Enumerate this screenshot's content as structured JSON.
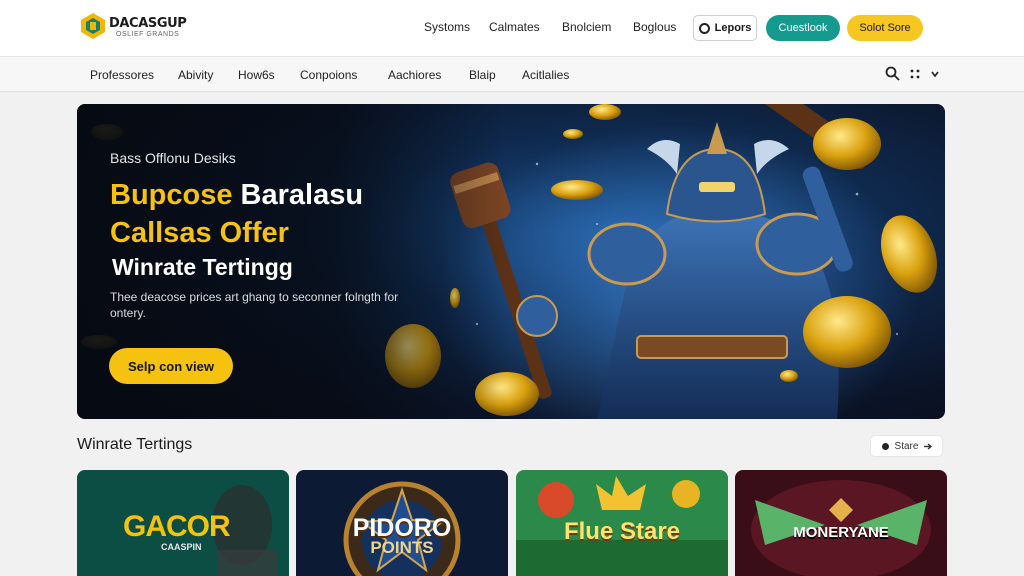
{
  "brand": {
    "title": "DACASGUP",
    "subtitle": "OSLIEF GRANDS"
  },
  "topnav": [
    "Systoms",
    "Calmates",
    "Bnolciem",
    "Boglous"
  ],
  "actions": {
    "login": "Lepors",
    "primary": "Cuestlook",
    "secondary": "Solot Sore"
  },
  "categories": [
    "Professores",
    "Abivity",
    "How6s",
    "Conpoions",
    "Aachiores",
    "Blaip",
    "Acitlalies"
  ],
  "hero": {
    "kicker": "Bass Offlonu Desiks",
    "headline_yellow_1": "Bupcose",
    "headline_white_1": "Baralasu",
    "headline_yellow_2": "Callsas Offer",
    "subheadline": "Winrate Tertingg",
    "description": "Thee deacose prices art ghang to seconner folngth for ontery.",
    "cta": "Selp con view"
  },
  "section": {
    "title": "Winrate Tertings",
    "more": "Stare"
  },
  "cards": [
    {
      "title": "GACOR",
      "subtitle": "CAASPIN"
    },
    {
      "title": "PIDORO",
      "subtitle": "POINTS"
    },
    {
      "title": "Flue Stare",
      "subtitle": ""
    },
    {
      "title": "MONERYANE",
      "subtitle": ""
    }
  ],
  "colors": {
    "accent_yellow": "#f5c20f",
    "teal": "#159b8e",
    "hero_bg": "#0f2a4f"
  },
  "icons": [
    "logo-icon",
    "login-icon",
    "search-icon",
    "grid-icon",
    "chevron-down-icon",
    "arrow-right-icon"
  ]
}
